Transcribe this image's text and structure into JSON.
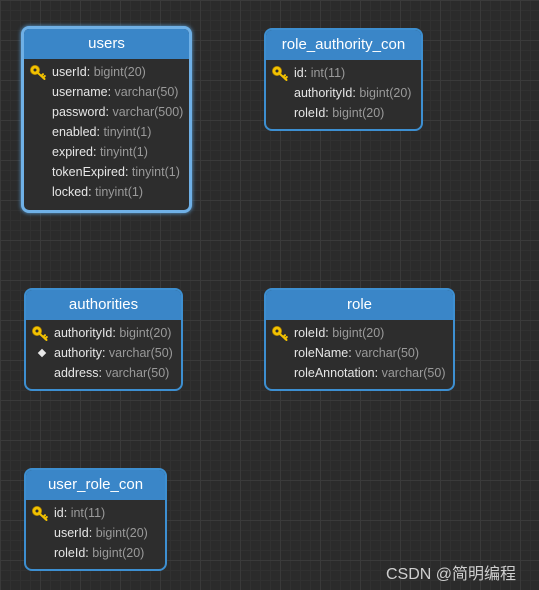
{
  "tables": [
    {
      "name": "users",
      "fields": [
        {
          "name": "userId",
          "type": "bigint(20)",
          "key": "primary"
        },
        {
          "name": "username",
          "type": "varchar(50)",
          "key": ""
        },
        {
          "name": "password",
          "type": "varchar(500)",
          "key": ""
        },
        {
          "name": "enabled",
          "type": "tinyint(1)",
          "key": ""
        },
        {
          "name": "expired",
          "type": "tinyint(1)",
          "key": ""
        },
        {
          "name": "tokenExpired",
          "type": "tinyint(1)",
          "key": ""
        },
        {
          "name": "locked",
          "type": "tinyint(1)",
          "key": ""
        }
      ]
    },
    {
      "name": "role_authority_con",
      "fields": [
        {
          "name": "id",
          "type": "int(11)",
          "key": "primary"
        },
        {
          "name": "authorityId",
          "type": "bigint(20)",
          "key": ""
        },
        {
          "name": "roleId",
          "type": "bigint(20)",
          "key": ""
        }
      ]
    },
    {
      "name": "authorities",
      "fields": [
        {
          "name": "authorityId",
          "type": "bigint(20)",
          "key": "primary"
        },
        {
          "name": "authority",
          "type": "varchar(50)",
          "key": "index"
        },
        {
          "name": "address",
          "type": "varchar(50)",
          "key": ""
        }
      ]
    },
    {
      "name": "role",
      "fields": [
        {
          "name": "roleId",
          "type": "bigint(20)",
          "key": "primary"
        },
        {
          "name": "roleName",
          "type": "varchar(50)",
          "key": ""
        },
        {
          "name": "roleAnnotation",
          "type": "varchar(50)",
          "key": ""
        }
      ]
    },
    {
      "name": "user_role_con",
      "fields": [
        {
          "name": "id",
          "type": "int(11)",
          "key": "primary"
        },
        {
          "name": "userId",
          "type": "bigint(20)",
          "key": ""
        },
        {
          "name": "roleId",
          "type": "bigint(20)",
          "key": ""
        }
      ]
    }
  ],
  "watermark": "CSDN @简明编程",
  "colors": {
    "header": "#3a86c8",
    "border": "#3d8fd1",
    "key": "#f2c200",
    "background": "#2b2b2b"
  }
}
